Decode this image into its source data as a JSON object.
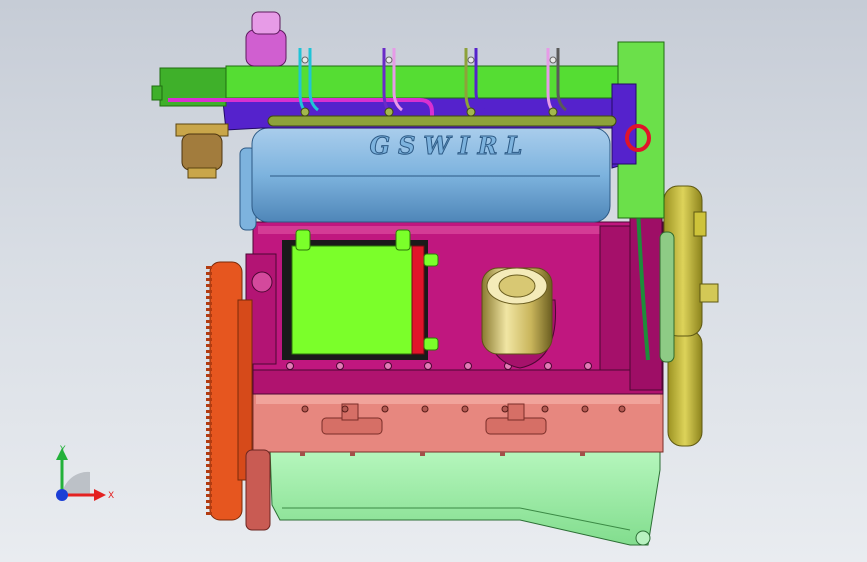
{
  "viewport": {
    "background_top": "#c6ccd6",
    "background_bottom": "#e9ecf0"
  },
  "model": {
    "cover_lettering": "GSWIRL",
    "colors": {
      "valve_cover": "#55dd33",
      "intake_manifold": "#5522cc",
      "head_tube": "#7db3de",
      "block": "#c0177f",
      "block_lower": "#e7877f",
      "oil_pan": "#9ef0a8",
      "flywheel": "#e6561f",
      "pulley": "#cec33a",
      "filter_cap": "#d8c873",
      "cooler": "#7bff2a",
      "red_accent": "#e0142a"
    }
  },
  "triad": {
    "y_label": "Y",
    "x_label": "X",
    "y_color": "#23b13a",
    "x_color": "#e42121",
    "z_color": "#1b3ed6"
  }
}
